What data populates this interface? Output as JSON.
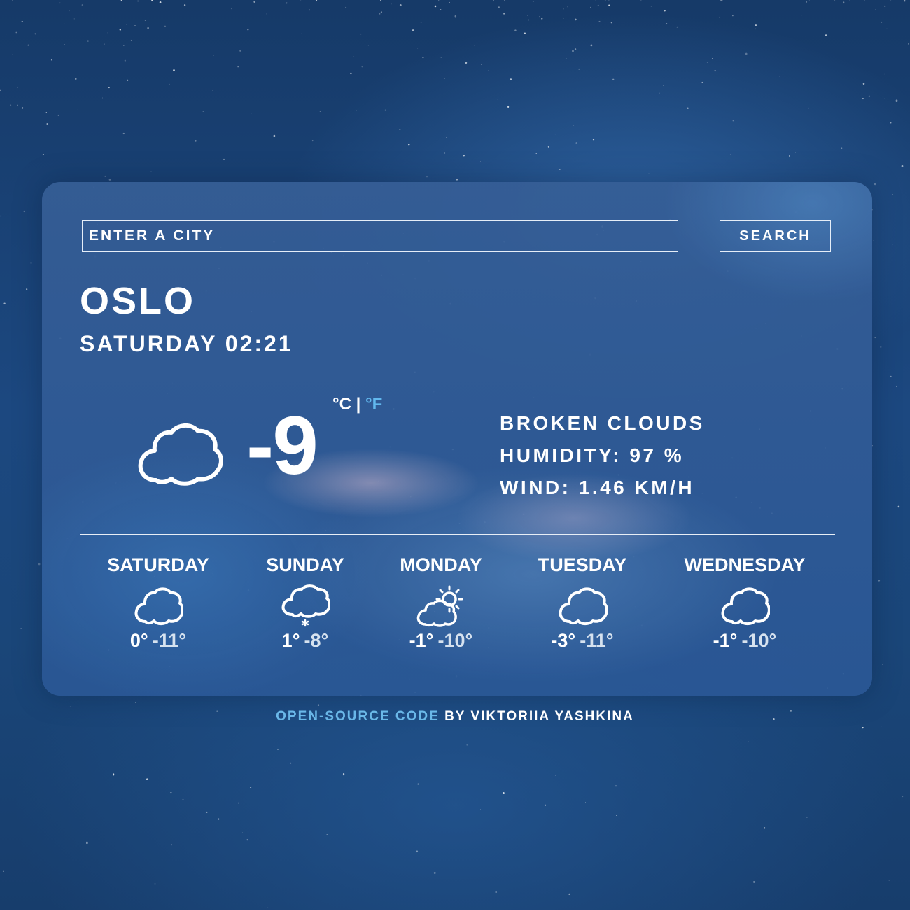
{
  "search": {
    "placeholder": "ENTER A CITY",
    "button_label": "SEARCH"
  },
  "current": {
    "city": "OSLO",
    "datetime": "SATURDAY 02:21",
    "icon": "broken-clouds-icon",
    "temperature": "-9",
    "unit_celsius": "°C",
    "unit_separator": "|",
    "unit_fahrenheit": "°F",
    "description": "BROKEN CLOUDS",
    "humidity": "HUMIDITY: 97 %",
    "wind": "WIND: 1.46 KM/H"
  },
  "forecast": [
    {
      "day": "SATURDAY",
      "icon": "cloud-icon",
      "max": "0°",
      "min": "-11°"
    },
    {
      "day": "SUNDAY",
      "icon": "snow-cloud-icon",
      "max": "1°",
      "min": "-8°"
    },
    {
      "day": "MONDAY",
      "icon": "partly-sunny-icon",
      "max": "-1°",
      "min": "-10°"
    },
    {
      "day": "TUESDAY",
      "icon": "cloud-icon",
      "max": "-3°",
      "min": "-11°"
    },
    {
      "day": "WEDNESDAY",
      "icon": "cloud-icon",
      "max": "-1°",
      "min": "-10°"
    }
  ],
  "footer": {
    "link_text": "OPEN-SOURCE CODE",
    "by_text": "BY VIKTORIIA YASHKINA"
  },
  "colors": {
    "accent": "#62b8ee",
    "text": "#ffffff",
    "background": "#1c4880"
  }
}
